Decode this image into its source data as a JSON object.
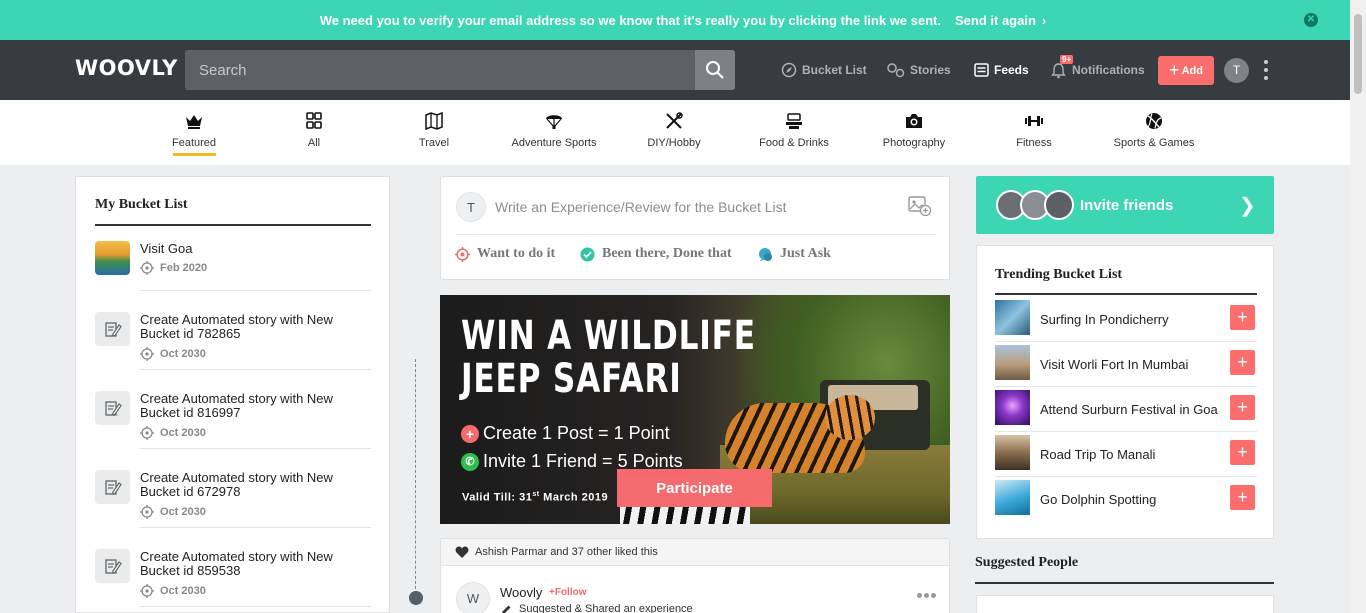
{
  "verify_banner": {
    "text": "We need you to verify your email address so we know that it's really you by clicking the link we sent.",
    "link": "Send it again",
    "color": "#3cd6b4"
  },
  "header": {
    "logo": "WOOVLY",
    "search_placeholder": "Search",
    "nav": {
      "bucket_list": "Bucket List",
      "stories": "Stories",
      "feeds": "Feeds",
      "notifications": "Notifications",
      "notif_badge": "9+",
      "add": "Add",
      "avatar_initial": "T"
    }
  },
  "categories": [
    {
      "label": "Featured",
      "icon": "crown-icon"
    },
    {
      "label": "All",
      "icon": "grid-icon"
    },
    {
      "label": "Travel",
      "icon": "map-icon"
    },
    {
      "label": "Adventure Sports",
      "icon": "parachute-icon"
    },
    {
      "label": "DIY/Hobby",
      "icon": "tools-icon"
    },
    {
      "label": "Food & Drinks",
      "icon": "food-icon"
    },
    {
      "label": "Photography",
      "icon": "camera-icon"
    },
    {
      "label": "Fitness",
      "icon": "dumbbell-icon"
    },
    {
      "label": "Sports & Games",
      "icon": "ball-icon"
    }
  ],
  "my_bucket_list": {
    "title": "My Bucket List",
    "items": [
      {
        "title": "Visit Goa",
        "date": "Feb 2020"
      },
      {
        "title": "Create Automated story with New Bucket id 782865",
        "date": "Oct 2030"
      },
      {
        "title": "Create Automated story with New Bucket id 816997",
        "date": "Oct 2030"
      },
      {
        "title": "Create Automated story with New Bucket id 672978",
        "date": "Oct 2030"
      },
      {
        "title": "Create Automated story with New Bucket id 859538",
        "date": "Oct 2030"
      }
    ]
  },
  "composer": {
    "avatar_initial": "T",
    "placeholder": "Write an Experience/Review for the Bucket List",
    "options": [
      "Want to do it",
      "Been there, Done that",
      "Just Ask"
    ]
  },
  "promo": {
    "headline_1": "WIN A WILDLIFE",
    "headline_2": "JEEP SAFARI",
    "point_1": "Create 1 Post = 1 Point",
    "point_2": "Invite 1 Friend = 5 Points",
    "valid_prefix": "Valid Till: 31",
    "valid_sup": "st",
    "valid_suffix": " March 2019",
    "button": "Participate"
  },
  "post": {
    "liked_text": "Ashish Parmar and 37 other liked this",
    "avatar_initial": "W",
    "author": "Woovly",
    "follow": "+Follow",
    "subtitle": "Suggested & Shared an experience"
  },
  "invite": {
    "label": "Invite friends"
  },
  "trending": {
    "title": "Trending Bucket List",
    "items": [
      {
        "name": "Surfing In Pondicherry"
      },
      {
        "name": "Visit Worli Fort In Mumbai"
      },
      {
        "name": "Attend Surburn Festival in Goa"
      },
      {
        "name": "Road Trip To Manali"
      },
      {
        "name": "Go Dolphin Spotting"
      }
    ]
  },
  "suggested": {
    "title": "Suggested People"
  }
}
